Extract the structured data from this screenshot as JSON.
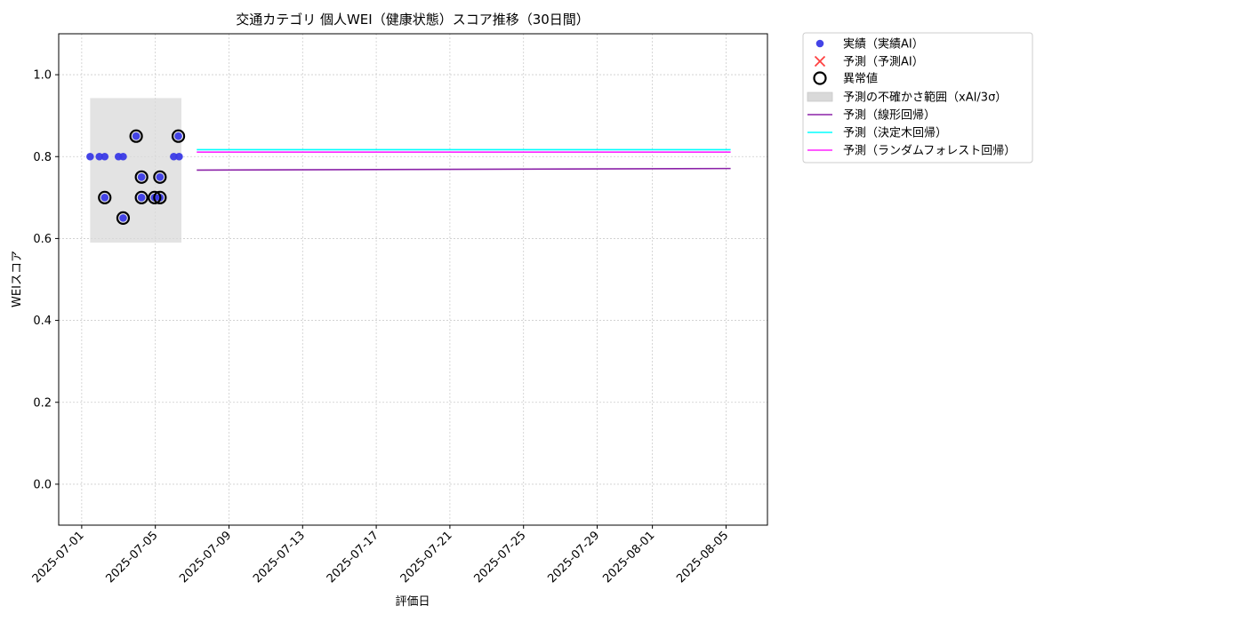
{
  "chart_data": {
    "type": "scatter",
    "title": "交通カテゴリ 個人WEI（健康状態）スコア推移（30日間）",
    "xlabel": "評価日",
    "ylabel": "WEIスコア",
    "xlim": [
      "2025-06-29T18:00",
      "2025-08-07T06:00"
    ],
    "ylim": [
      -0.1,
      1.1
    ],
    "grid": true,
    "x_ticks": [
      "2025-07-01",
      "2025-07-05",
      "2025-07-09",
      "2025-07-13",
      "2025-07-17",
      "2025-07-21",
      "2025-07-25",
      "2025-07-29",
      "2025-08-01",
      "2025-08-05"
    ],
    "y_ticks": [
      0.0,
      0.2,
      0.4,
      0.6,
      0.8,
      1.0
    ],
    "y_tick_labels": [
      "0.0",
      "0.2",
      "0.4",
      "0.6",
      "0.8",
      "1.0"
    ],
    "uncertainty_band": {
      "label": "予測の不確かさ範囲（xAI/3σ）",
      "x": [
        "2025-07-01T11:00",
        "2025-07-06T10:00"
      ],
      "y": [
        0.59,
        0.943
      ],
      "color": "#d9d9d9"
    },
    "actual": {
      "label": "実績（実績AI）",
      "color": "#3a3ae6",
      "points": [
        {
          "x": "2025-07-01T11:00",
          "y": 0.8
        },
        {
          "x": "2025-07-01T23:00",
          "y": 0.8
        },
        {
          "x": "2025-07-02T06:00",
          "y": 0.8
        },
        {
          "x": "2025-07-02T06:00",
          "y": 0.7
        },
        {
          "x": "2025-07-03T00:00",
          "y": 0.8
        },
        {
          "x": "2025-07-03T06:00",
          "y": 0.65
        },
        {
          "x": "2025-07-03T06:00",
          "y": 0.8
        },
        {
          "x": "2025-07-03T23:00",
          "y": 0.85
        },
        {
          "x": "2025-07-04T06:00",
          "y": 0.75
        },
        {
          "x": "2025-07-04T06:00",
          "y": 0.7
        },
        {
          "x": "2025-07-04T23:00",
          "y": 0.7
        },
        {
          "x": "2025-07-05T06:00",
          "y": 0.75
        },
        {
          "x": "2025-07-05T06:00",
          "y": 0.7
        },
        {
          "x": "2025-07-06T00:00",
          "y": 0.8
        },
        {
          "x": "2025-07-06T06:00",
          "y": 0.85
        },
        {
          "x": "2025-07-06T07:00",
          "y": 0.8
        }
      ]
    },
    "forecast_points": {
      "label": "予測（予測AI）",
      "color": "#ff4040",
      "points": []
    },
    "anomalies": {
      "label": "異常値",
      "points": [
        {
          "x": "2025-07-02T06:00",
          "y": 0.7
        },
        {
          "x": "2025-07-03T06:00",
          "y": 0.65
        },
        {
          "x": "2025-07-03T23:00",
          "y": 0.85
        },
        {
          "x": "2025-07-04T06:00",
          "y": 0.75
        },
        {
          "x": "2025-07-04T06:00",
          "y": 0.7
        },
        {
          "x": "2025-07-04T23:00",
          "y": 0.7
        },
        {
          "x": "2025-07-05T06:00",
          "y": 0.75
        },
        {
          "x": "2025-07-05T06:00",
          "y": 0.7
        },
        {
          "x": "2025-07-06T06:00",
          "y": 0.85
        }
      ]
    },
    "series": [
      {
        "name": "予測（線形回帰）",
        "color": "#8b22a8",
        "x": [
          "2025-07-07T06:00",
          "2025-08-05T06:00"
        ],
        "values": [
          0.767,
          0.771
        ]
      },
      {
        "name": "予測（決定木回帰）",
        "color": "#00ffff",
        "x": [
          "2025-07-07T06:00",
          "2025-08-05T06:00"
        ],
        "values": [
          0.817,
          0.817
        ]
      },
      {
        "name": "予測（ランダムフォレスト回帰）",
        "color": "#ff22ff",
        "x": [
          "2025-07-07T06:00",
          "2025-08-05T06:00"
        ],
        "values": [
          0.811,
          0.811
        ]
      }
    ],
    "legend": {
      "placement": "outside-upper-right",
      "entries": [
        {
          "label": "実績（実績AI）",
          "marker": "dot",
          "color": "#3a3ae6"
        },
        {
          "label": "予測（予測AI）",
          "marker": "x",
          "color": "#ff4040"
        },
        {
          "label": "異常値",
          "marker": "ring",
          "color": "#000000"
        },
        {
          "label": "予測の不確かさ範囲（xAI/3σ）",
          "marker": "patch",
          "color": "#d9d9d9"
        },
        {
          "label": "予測（線形回帰）",
          "marker": "line",
          "color": "#8b22a8"
        },
        {
          "label": "予測（決定木回帰）",
          "marker": "line",
          "color": "#00ffff"
        },
        {
          "label": "予測（ランダムフォレスト回帰）",
          "marker": "line",
          "color": "#ff22ff"
        }
      ]
    }
  }
}
